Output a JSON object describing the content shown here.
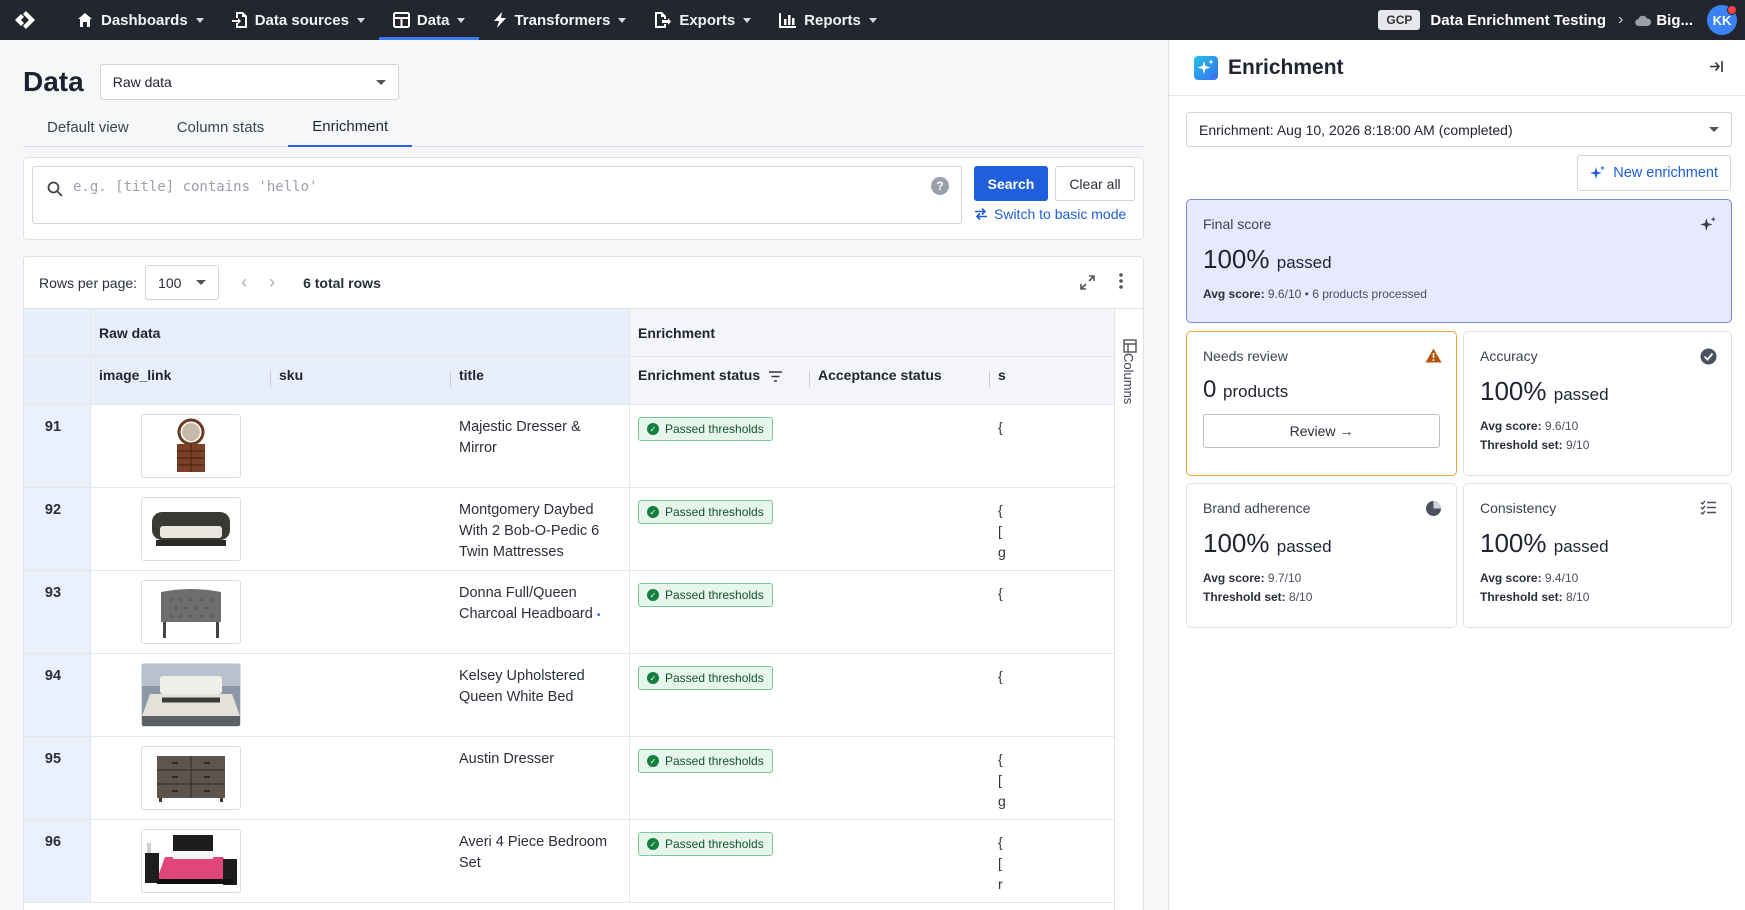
{
  "nav": {
    "items": [
      {
        "label": "Dashboards",
        "icon": "home-icon"
      },
      {
        "label": "Data sources",
        "icon": "file-import-icon"
      },
      {
        "label": "Data",
        "icon": "table-icon"
      },
      {
        "label": "Transformers",
        "icon": "bolt-icon"
      },
      {
        "label": "Exports",
        "icon": "file-export-icon"
      },
      {
        "label": "Reports",
        "icon": "bar-chart-icon"
      }
    ],
    "active": "Data",
    "env_badge": "GCP",
    "project": "Data Enrichment Testing",
    "store": "Big...",
    "avatar_initials": "KK"
  },
  "page": {
    "title": "Data",
    "view_select": "Raw data",
    "tabs": [
      "Default view",
      "Column stats",
      "Enrichment"
    ],
    "active_tab": "Enrichment"
  },
  "search": {
    "placeholder": "e.g. [title] contains 'hello'",
    "value": "",
    "help": "?",
    "search_label": "Search",
    "clear_label": "Clear all",
    "switch_label": "Switch to basic mode"
  },
  "table": {
    "rows_per_page_label": "Rows per page:",
    "rows_per_page": "100",
    "total_rows": "6 total rows",
    "group_raw": "Raw data",
    "group_enrichment": "Enrichment",
    "columns": [
      "image_link",
      "sku",
      "title",
      "Enrichment status",
      "Acceptance status",
      "s"
    ],
    "columns_toggle": "Columns",
    "rows": [
      {
        "num": "91",
        "title": "Majestic Dresser & Mirror",
        "status": "Passed thresholds",
        "extra": "{",
        "img": "dresser-mirror"
      },
      {
        "num": "92",
        "title": "Montgomery Daybed With 2 Bob-O-Pedic 6 Twin Mattresses",
        "status": "Passed thresholds",
        "extra": "{\n[\ng",
        "img": "daybed"
      },
      {
        "num": "93",
        "title": "Donna Full/Queen Charcoal Headboard",
        "status": "Passed thresholds",
        "extra": "{",
        "img": "headboard",
        "dot": true
      },
      {
        "num": "94",
        "title": "Kelsey Upholstered Queen White Bed",
        "status": "Passed thresholds",
        "extra": "{",
        "img": "bed"
      },
      {
        "num": "95",
        "title": "Austin Dresser",
        "status": "Passed thresholds",
        "extra": "{\n[\ng",
        "img": "dresser"
      },
      {
        "num": "96",
        "title": "Averi 4 Piece Bedroom Set",
        "status": "Passed thresholds",
        "extra": "{\n[\nr",
        "img": "bedroom-set"
      }
    ]
  },
  "panel": {
    "title": "Enrichment",
    "run_select": "Enrichment: Aug 10, 2026 8:18:00 AM (completed)",
    "new_label": "New enrichment",
    "final": {
      "title": "Final score",
      "value": "100%",
      "unit": "passed",
      "avg_label": "Avg score:",
      "avg": "9.6/10",
      "sep": "•",
      "processed": "6 products processed"
    },
    "review": {
      "title": "Needs review",
      "value": "0",
      "unit": "products",
      "button": "Review →"
    },
    "accuracy": {
      "title": "Accuracy",
      "value": "100%",
      "unit": "passed",
      "avg_label": "Avg score:",
      "avg": "9.6/10",
      "thr_label": "Threshold set:",
      "thr": "9/10"
    },
    "brand": {
      "title": "Brand adherence",
      "value": "100%",
      "unit": "passed",
      "avg_label": "Avg score:",
      "avg": "9.7/10",
      "thr_label": "Threshold set:",
      "thr": "8/10"
    },
    "consistency": {
      "title": "Consistency",
      "value": "100%",
      "unit": "passed",
      "avg_label": "Avg score:",
      "avg": "9.4/10",
      "thr_label": "Threshold set:",
      "thr": "8/10"
    }
  },
  "colors": {
    "accent": "#1f5fdb",
    "nav_bg": "#23262f",
    "success": "#15803d",
    "warning": "#f0a33c",
    "final_bg": "#e8e9fd"
  }
}
